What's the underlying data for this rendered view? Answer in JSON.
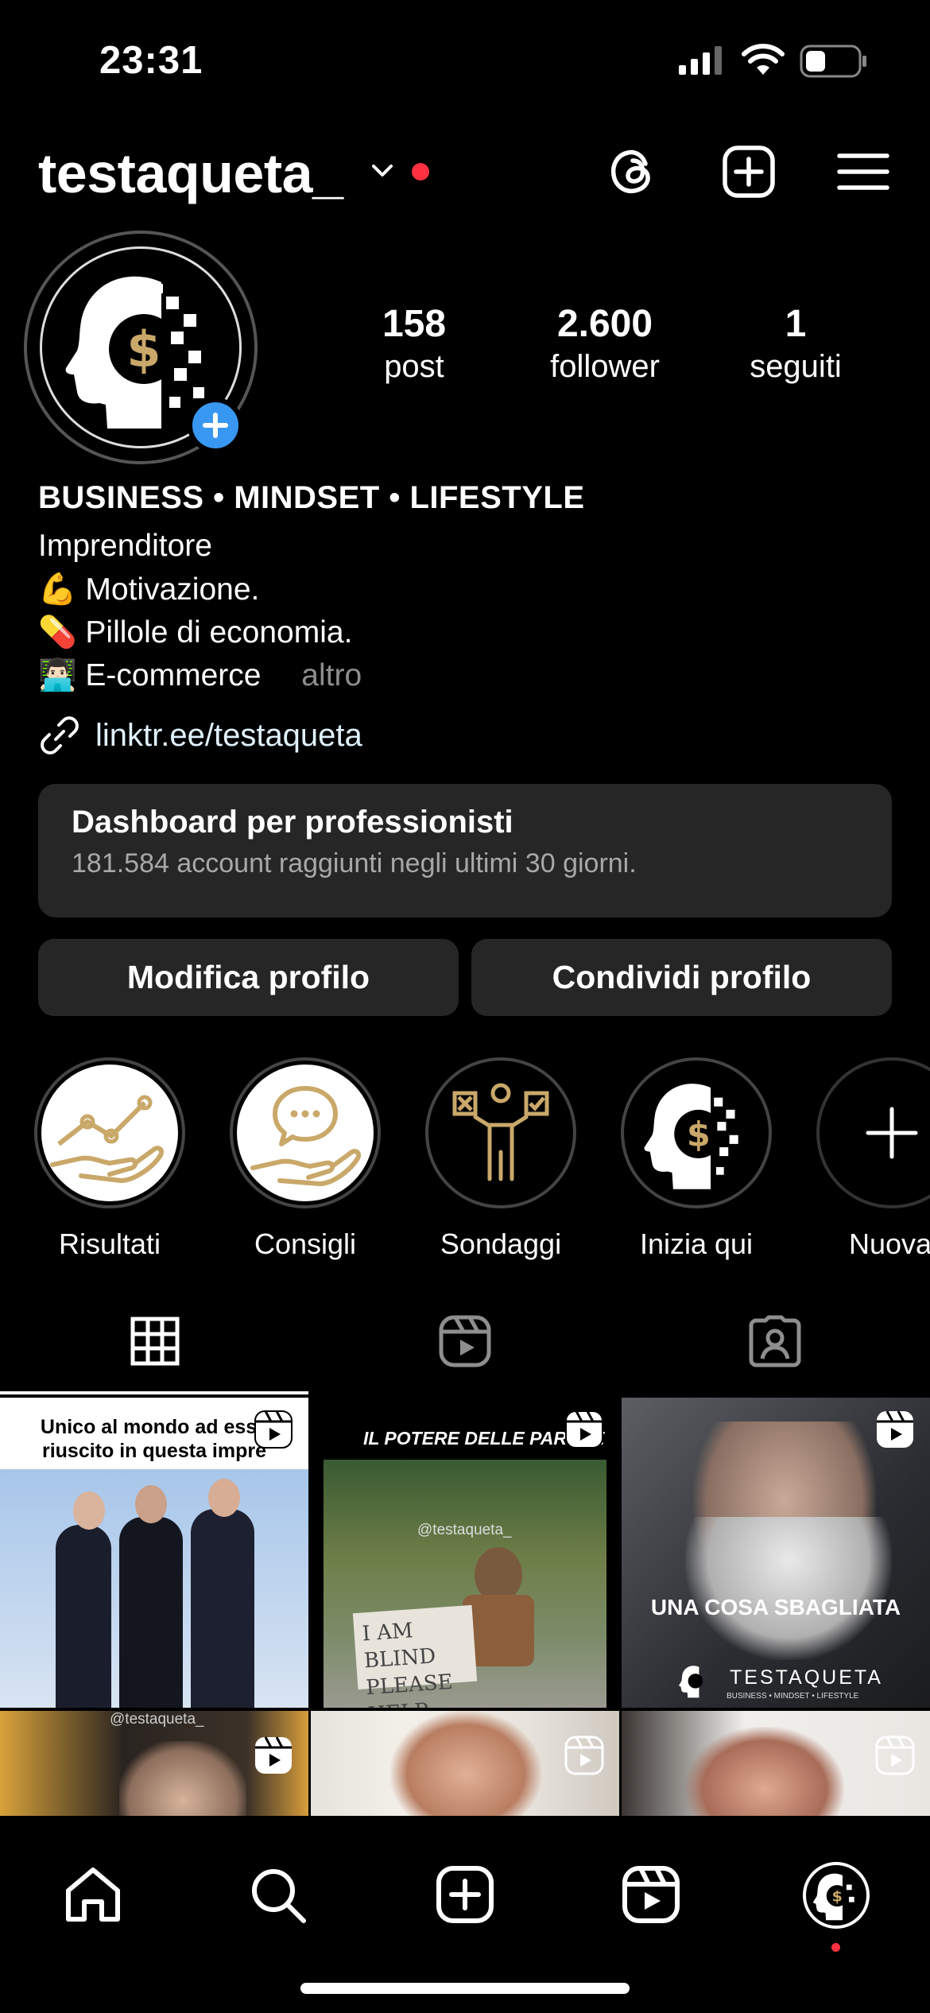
{
  "status_bar": {
    "time": "23:31"
  },
  "header": {
    "username": "testaqueta_"
  },
  "stats": [
    {
      "value": "158",
      "label": "post"
    },
    {
      "value": "2.600",
      "label": "follower"
    },
    {
      "value": "1",
      "label": "seguiti"
    }
  ],
  "bio": {
    "title": "BUSINESS • MINDSET • LIFESTYLE",
    "category": "Imprenditore",
    "lines": [
      {
        "emoji": "💪",
        "text": "Motivazione."
      },
      {
        "emoji": "💊",
        "text": "Pillole di economia."
      },
      {
        "emoji": "👨🏻‍💻",
        "text": "E-commerce"
      }
    ],
    "more": "altro",
    "link": "linktr.ee/testaqueta"
  },
  "dashboard": {
    "title": "Dashboard per professionisti",
    "subtitle": "181.584 account raggiunti negli ultimi 30 giorni."
  },
  "buttons": {
    "edit": "Modifica profilo",
    "share": "Condividi profilo"
  },
  "highlights": [
    {
      "label": "Risultati"
    },
    {
      "label": "Consigli"
    },
    {
      "label": "Sondaggi"
    },
    {
      "label": "Inizia qui"
    },
    {
      "label": "Nuova"
    }
  ],
  "posts": [
    {
      "caption": "Unico al mondo ad esse riuscito in questa impre"
    },
    {
      "caption": "IL POTERE DELLE PAROLE",
      "watermark": "@testaqueta_",
      "sign": "I AM BLIND PLEASE HELP"
    },
    {
      "caption": "UNA COSA SBAGLIATA",
      "brand": "TESTAQUETA",
      "brand_sub": "BUSINESS • MINDSET • LIFESTYLE"
    },
    {
      "watermark": "@testaqueta_"
    },
    {},
    {}
  ],
  "colors": {
    "accent_blue": "#3897f0",
    "notification_red": "#ff3040",
    "gold": "#c9a86a"
  }
}
